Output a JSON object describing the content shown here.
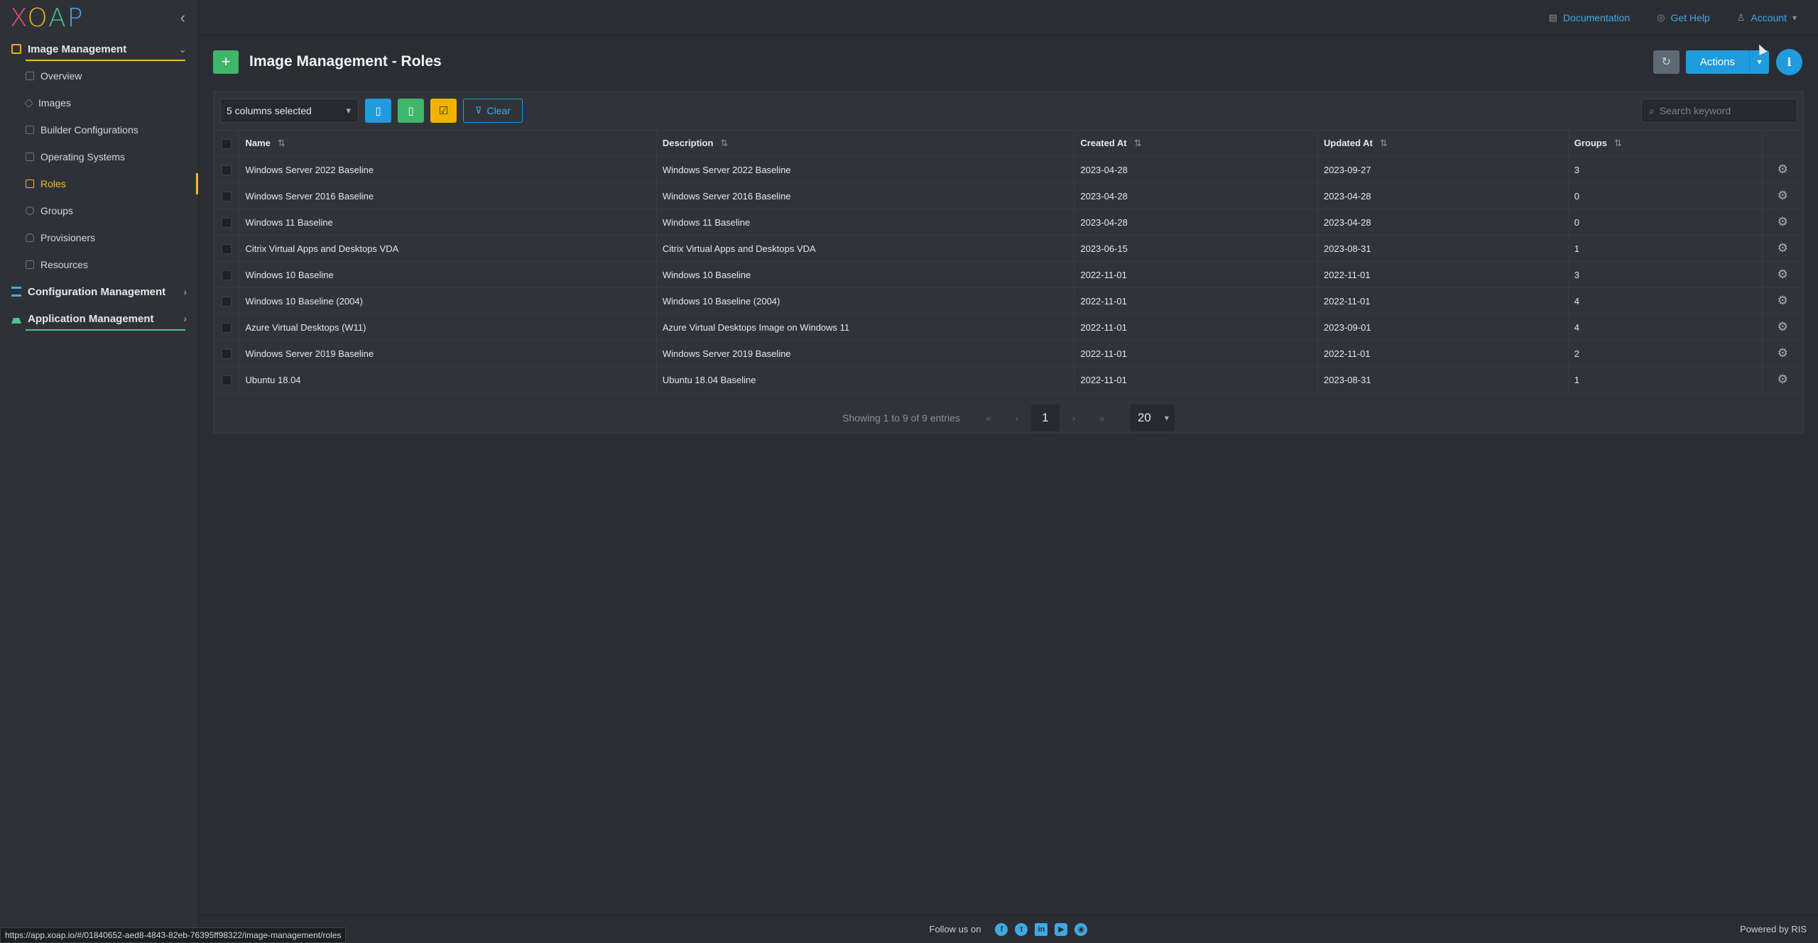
{
  "app": {
    "logo": [
      "X",
      "O",
      "A",
      "P"
    ]
  },
  "topbar": {
    "documentation": "Documentation",
    "get_help": "Get Help",
    "account": "Account"
  },
  "sidebar": {
    "sections": [
      {
        "label": "Image Management",
        "underline_color": "#f5b82e",
        "icon_color": "#f5a623"
      },
      {
        "label": "Configuration Management",
        "icon_color": "#3ab0e0"
      },
      {
        "label": "Application Management",
        "underline_color": "#4cc38a",
        "icon_color": "#4cc38a"
      }
    ],
    "items": [
      {
        "label": "Overview"
      },
      {
        "label": "Images"
      },
      {
        "label": "Builder Configurations"
      },
      {
        "label": "Operating Systems"
      },
      {
        "label": "Roles"
      },
      {
        "label": "Groups"
      },
      {
        "label": "Provisioners"
      },
      {
        "label": "Resources"
      }
    ]
  },
  "page": {
    "title": "Image Management - Roles",
    "actions_label": "Actions"
  },
  "toolbar": {
    "columns_selected": "5 columns selected",
    "clear_label": "Clear",
    "search_placeholder": "Search keyword"
  },
  "table": {
    "headers": [
      "Name",
      "Description",
      "Created At",
      "Updated At",
      "Groups"
    ],
    "rows": [
      [
        "Windows Server 2022 Baseline",
        "Windows Server 2022 Baseline",
        "2023-04-28",
        "2023-09-27",
        "3"
      ],
      [
        "Windows Server 2016 Baseline",
        "Windows Server 2016 Baseline",
        "2023-04-28",
        "2023-04-28",
        "0"
      ],
      [
        "Windows 11 Baseline",
        "Windows 11 Baseline",
        "2023-04-28",
        "2023-04-28",
        "0"
      ],
      [
        "Citrix Virtual Apps and Desktops VDA",
        "Citrix Virtual Apps and Desktops VDA",
        "2023-06-15",
        "2023-08-31",
        "1"
      ],
      [
        "Windows 10 Baseline",
        "Windows 10 Baseline",
        "2022-11-01",
        "2022-11-01",
        "3"
      ],
      [
        "Windows 10 Baseline (2004)",
        "Windows 10 Baseline (2004)",
        "2022-11-01",
        "2022-11-01",
        "4"
      ],
      [
        "Azure Virtual Desktops (W11)",
        "Azure Virtual Desktops Image on Windows 11",
        "2022-11-01",
        "2023-09-01",
        "4"
      ],
      [
        "Windows Server 2019 Baseline",
        "Windows Server 2019 Baseline",
        "2022-11-01",
        "2022-11-01",
        "2"
      ],
      [
        "Ubuntu 18.04",
        "Ubuntu 18.04 Baseline",
        "2022-11-01",
        "2023-08-31",
        "1"
      ]
    ]
  },
  "pagination": {
    "info": "Showing 1 to 9 of 9 entries",
    "current_page": "1",
    "per_page": "20"
  },
  "footer": {
    "follow_us": "Follow us on",
    "powered_by": "Powered by RIS",
    "social_icons": [
      "facebook-icon",
      "twitter-icon",
      "linkedin-icon",
      "youtube-icon",
      "github-icon"
    ]
  },
  "status_bar": {
    "url": "https://app.xoap.io/#/01840652-aed8-4843-82eb-76395ff98322/image-management/roles"
  }
}
